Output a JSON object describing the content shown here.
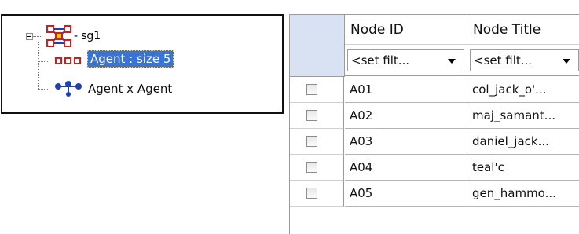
{
  "tree": {
    "root": {
      "label": "sg1",
      "icon": "network-group-icon"
    },
    "children": [
      {
        "label": "Agent : size 5",
        "icon": "node-set-icon",
        "selected": true
      },
      {
        "label": "Agent x Agent",
        "icon": "network-icon",
        "selected": false
      }
    ]
  },
  "grid": {
    "columns": [
      {
        "header": "Node ID",
        "filter": "<set filt..."
      },
      {
        "header": "Node Title",
        "filter": "<set filt..."
      }
    ],
    "rows": [
      {
        "id": "A01",
        "title": "col_jack_o'...",
        "checked": false
      },
      {
        "id": "A02",
        "title": "maj_samant...",
        "checked": false
      },
      {
        "id": "A03",
        "title": "daniel_jack...",
        "checked": false
      },
      {
        "id": "A04",
        "title": "teal'c",
        "checked": false
      },
      {
        "id": "A05",
        "title": "gen_hammo...",
        "checked": false
      }
    ]
  },
  "colors": {
    "selection": "#3a73d6",
    "corner": "#d9e2f3",
    "icon_red": "#cc1f1f",
    "icon_blue": "#1e3fb0"
  }
}
